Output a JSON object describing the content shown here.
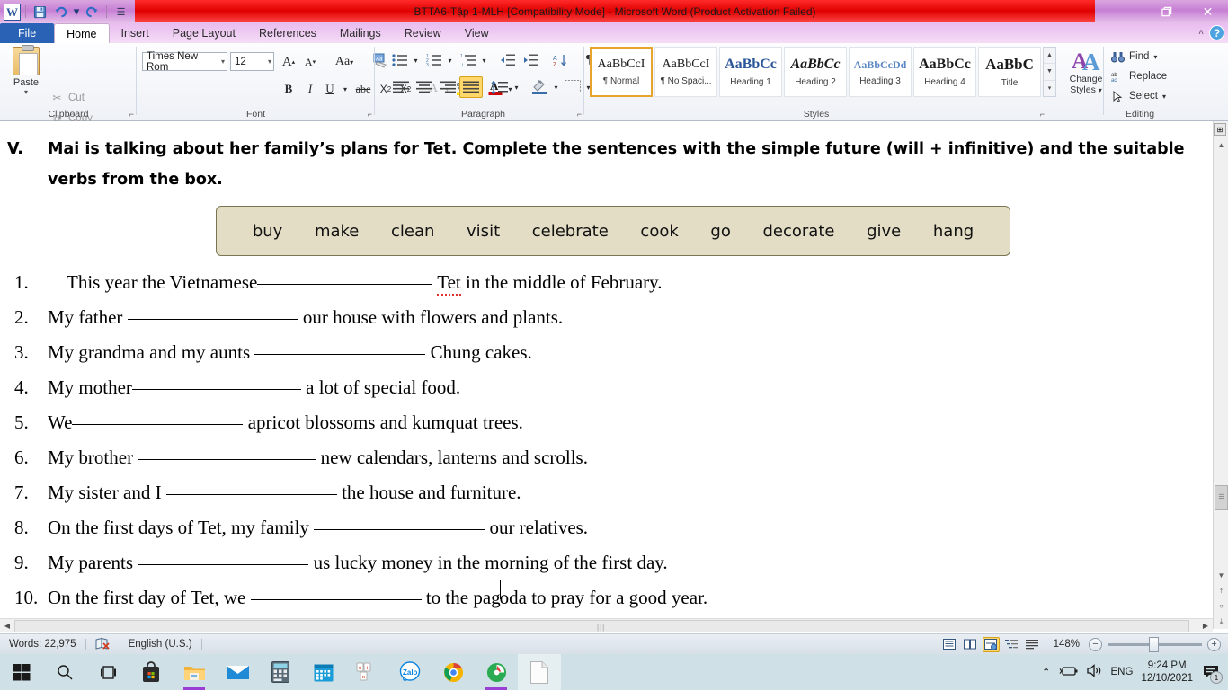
{
  "titlebar": {
    "document_title": "BTTA6-Tập 1-MLH [Compatibility Mode]  -  Microsoft Word (Product Activation Failed)",
    "quick_access": [
      {
        "name": "word-logo",
        "label": "W"
      },
      {
        "name": "save-icon",
        "label": "ὋE"
      },
      {
        "name": "undo-icon",
        "label": "↶"
      },
      {
        "name": "undo-dropdown-icon",
        "label": "▾"
      },
      {
        "name": "redo-icon",
        "label": "↻"
      },
      {
        "name": "customize-qat-icon",
        "label": "☰"
      }
    ],
    "minimize": "—",
    "restore": "❐",
    "close": "✕",
    "ribbon_collapse": "˄",
    "help": "?"
  },
  "tabs": [
    {
      "label": "File",
      "active": false,
      "file": true
    },
    {
      "label": "Home",
      "active": true
    },
    {
      "label": "Insert",
      "active": false
    },
    {
      "label": "Page Layout",
      "active": false
    },
    {
      "label": "References",
      "active": false
    },
    {
      "label": "Mailings",
      "active": false
    },
    {
      "label": "Review",
      "active": false
    },
    {
      "label": "View",
      "active": false
    }
  ],
  "ribbon": {
    "clipboard": {
      "group_label": "Clipboard",
      "paste": "Paste",
      "cut": "Cut",
      "copy": "Copy",
      "format_painter": "Format Painter"
    },
    "font": {
      "group_label": "Font",
      "font_name": "Times New Rom",
      "font_size": "12",
      "grow_font": "A",
      "shrink_font": "A",
      "change_case": "Aa",
      "clear_formatting": "A",
      "bold": "B",
      "italic": "I",
      "underline": "U",
      "strikethrough": "abc",
      "subscript": "X₂",
      "superscript": "X²",
      "text_effects": "A",
      "highlight": "ab",
      "font_color": "A"
    },
    "paragraph": {
      "group_label": "Paragraph",
      "bullets": "☰",
      "numbering": "☰",
      "multilevel": "☰",
      "decrease_indent": "⬅",
      "increase_indent": "➡",
      "sort": "AZ↓",
      "show_marks": "¶",
      "align_left": "☰",
      "align_center": "☰",
      "align_right": "☰",
      "justify": "☰",
      "line_spacing": "↕",
      "shading": "■",
      "borders": "⊞"
    },
    "styles": {
      "group_label": "Styles",
      "gallery": [
        {
          "preview": "AaBbCcI",
          "name": "¶ Normal",
          "selected": true
        },
        {
          "preview": "AaBbCcI",
          "name": "¶ No Spaci...",
          "selected": false
        },
        {
          "preview": "AaBbCс",
          "name": "Heading 1",
          "selected": false
        },
        {
          "preview": "AaBbCс",
          "name": "Heading 2",
          "selected": false
        },
        {
          "preview": "AaBbCcDd",
          "name": "Heading 3",
          "selected": false
        },
        {
          "preview": "AaBbCc",
          "name": "Heading 4",
          "selected": false
        },
        {
          "preview": "AaBbC",
          "name": "Title",
          "selected": false
        }
      ],
      "change_styles": "Change\nStyles",
      "change_styles_line1": "Change",
      "change_styles_line2": "Styles"
    },
    "editing": {
      "group_label": "Editing",
      "find": "Find",
      "replace": "Replace",
      "select": "Select"
    }
  },
  "document": {
    "question_number": "V.",
    "question_text": "Mai is talking about her family’s plans for Tet. Complete the sentences with the simple future (will + infinitive) and the suitable verbs from the box.",
    "word_box": [
      "buy",
      "make",
      "clean",
      "visit",
      "celebrate",
      "cook",
      "go",
      "decorate",
      "give",
      "hang"
    ],
    "word_box_bg": "#e3ddc5",
    "word_box_border": "#7a7550",
    "items": [
      {
        "num": "1.",
        "pre": "    This year the Vietnamese",
        "blank_width": 195,
        "post": " Tet in the middle of February.",
        "misspelled": "Tet"
      },
      {
        "num": "2.",
        "pre": "My father ",
        "blank_width": 190,
        "post": " our house with flowers and plants."
      },
      {
        "num": "3.",
        "pre": "My grandma and my aunts ",
        "blank_width": 190,
        "post": " Chung cakes."
      },
      {
        "num": "4.",
        "pre": "My mother",
        "blank_width": 188,
        "post": " a lot of special food."
      },
      {
        "num": "5.",
        "pre": "We",
        "blank_width": 190,
        "post": " apricot blossoms and kumquat trees."
      },
      {
        "num": "6.",
        "pre": "My brother ",
        "blank_width": 198,
        "post": " new calendars, lanterns and scrolls."
      },
      {
        "num": "7.",
        "pre": "My sister and I ",
        "blank_width": 190,
        "post": " the house and furniture."
      },
      {
        "num": "8.",
        "pre": "On the first days of Tet, my family ",
        "blank_width": 190,
        "post": " our relatives."
      },
      {
        "num": "9.",
        "pre": "My parents ",
        "blank_width": 190,
        "post": " us lucky money in the morning of the first day."
      },
      {
        "num": "10.",
        "pre": "On the first day of Tet, we ",
        "blank_width": 190,
        "post": " to the pag|oda to pray for a good year.",
        "cursor": true
      }
    ]
  },
  "statusbar": {
    "words": "Words: 22,975",
    "language": "English (U.S.)",
    "proofing_icon": "spell-check-error-icon",
    "zoom_level": "148%",
    "views": [
      {
        "name": "print-layout-view",
        "glyph": "▤",
        "selected": false
      },
      {
        "name": "full-screen-reading-view",
        "glyph": "▭",
        "selected": false
      },
      {
        "name": "web-layout-view",
        "glyph": "▥",
        "selected": true
      },
      {
        "name": "outline-view",
        "glyph": "≡",
        "selected": false
      },
      {
        "name": "draft-view",
        "glyph": "☰",
        "selected": false
      }
    ],
    "zoom_out": "−",
    "zoom_in": "+"
  },
  "taskbar": {
    "items": [
      {
        "name": "start-button",
        "glyph": "⊞",
        "active": false
      },
      {
        "name": "search-icon",
        "glyph": "⚲",
        "active": false
      },
      {
        "name": "task-view-icon",
        "glyph": "⌸",
        "active": false
      },
      {
        "name": "microsoft-store-icon",
        "glyph": "■",
        "active": false
      },
      {
        "name": "file-explorer-icon",
        "glyph": "■",
        "active": false,
        "underline": true
      },
      {
        "name": "mail-icon",
        "glyph": "✉",
        "active": false
      },
      {
        "name": "calculator-icon",
        "glyph": "▤",
        "active": false
      },
      {
        "name": "calendar-icon",
        "glyph": "▦",
        "active": false
      },
      {
        "name": "unikey-icon",
        "glyph": "ui",
        "active": false
      },
      {
        "name": "zalo-icon",
        "glyph": "Zalo",
        "active": false
      },
      {
        "name": "google-chrome-icon",
        "glyph": "●",
        "active": false
      },
      {
        "name": "coccoc-browser-icon",
        "glyph": "●",
        "active": false,
        "underline": true
      },
      {
        "name": "word-document-icon",
        "glyph": "▭",
        "active": true
      }
    ],
    "tray": {
      "show_hidden": "∧",
      "battery": "▭",
      "volume": "ὐA",
      "language": "ENG",
      "time": "9:24 PM",
      "date": "12/10/2021",
      "notification_count": "1"
    }
  }
}
